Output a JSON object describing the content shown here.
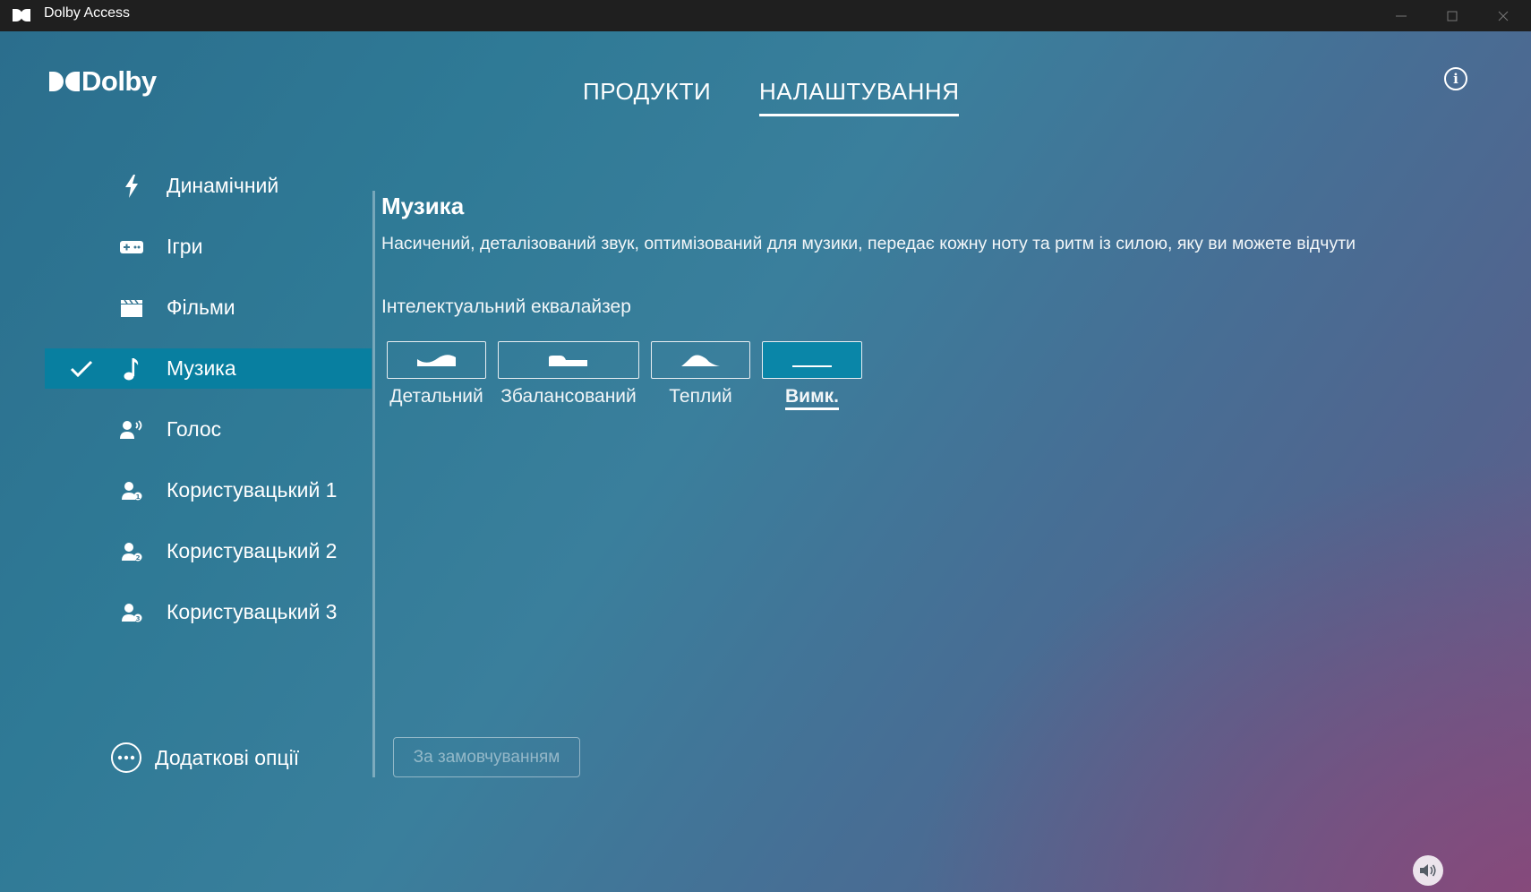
{
  "window": {
    "title": "Dolby Access",
    "titlebar_color": "#1f1f1f"
  },
  "brand": {
    "wordmark": "Dolby",
    "logo_icon": "dolby-double-d-icon"
  },
  "nav": {
    "tabs": [
      {
        "label": "ПРОДУКТИ",
        "active": false
      },
      {
        "label": "НАЛАШТУВАННЯ",
        "active": true
      }
    ],
    "info_icon": "info-icon"
  },
  "sidebar": {
    "items": [
      {
        "label": "Динамічний",
        "icon": "lightning-icon",
        "active": false
      },
      {
        "label": "Ігри",
        "icon": "gamepad-icon",
        "active": false
      },
      {
        "label": "Фільми",
        "icon": "clapperboard-icon",
        "active": false
      },
      {
        "label": "Музика",
        "icon": "music-note-icon",
        "active": true
      },
      {
        "label": "Голос",
        "icon": "voice-icon",
        "active": false
      },
      {
        "label": "Користувацький 1",
        "icon": "user-custom-1-icon",
        "active": false
      },
      {
        "label": "Користувацький 2",
        "icon": "user-custom-2-icon",
        "active": false
      },
      {
        "label": "Користувацький 3",
        "icon": "user-custom-3-icon",
        "active": false
      }
    ],
    "more_options": "Додаткові опції",
    "active_color": "#087fa0"
  },
  "content": {
    "title": "Музика",
    "description": "Насичений, деталізований звук, оптимізований для музики, передає кожну ноту та ритм із силою, яку ви можете відчути",
    "eq_heading": "Інтелектуальний еквалайзер",
    "eq_options": [
      {
        "label": "Детальний",
        "icon": "eq-detailed-icon",
        "selected": false
      },
      {
        "label": "Збалансований",
        "icon": "eq-balanced-icon",
        "selected": false
      },
      {
        "label": "Теплий",
        "icon": "eq-warm-icon",
        "selected": false
      },
      {
        "label": "Вимк.",
        "icon": "eq-off-icon",
        "selected": true
      }
    ],
    "reset_button": "За замовчуванням"
  },
  "footer": {
    "volume_icon": "volume-icon"
  }
}
